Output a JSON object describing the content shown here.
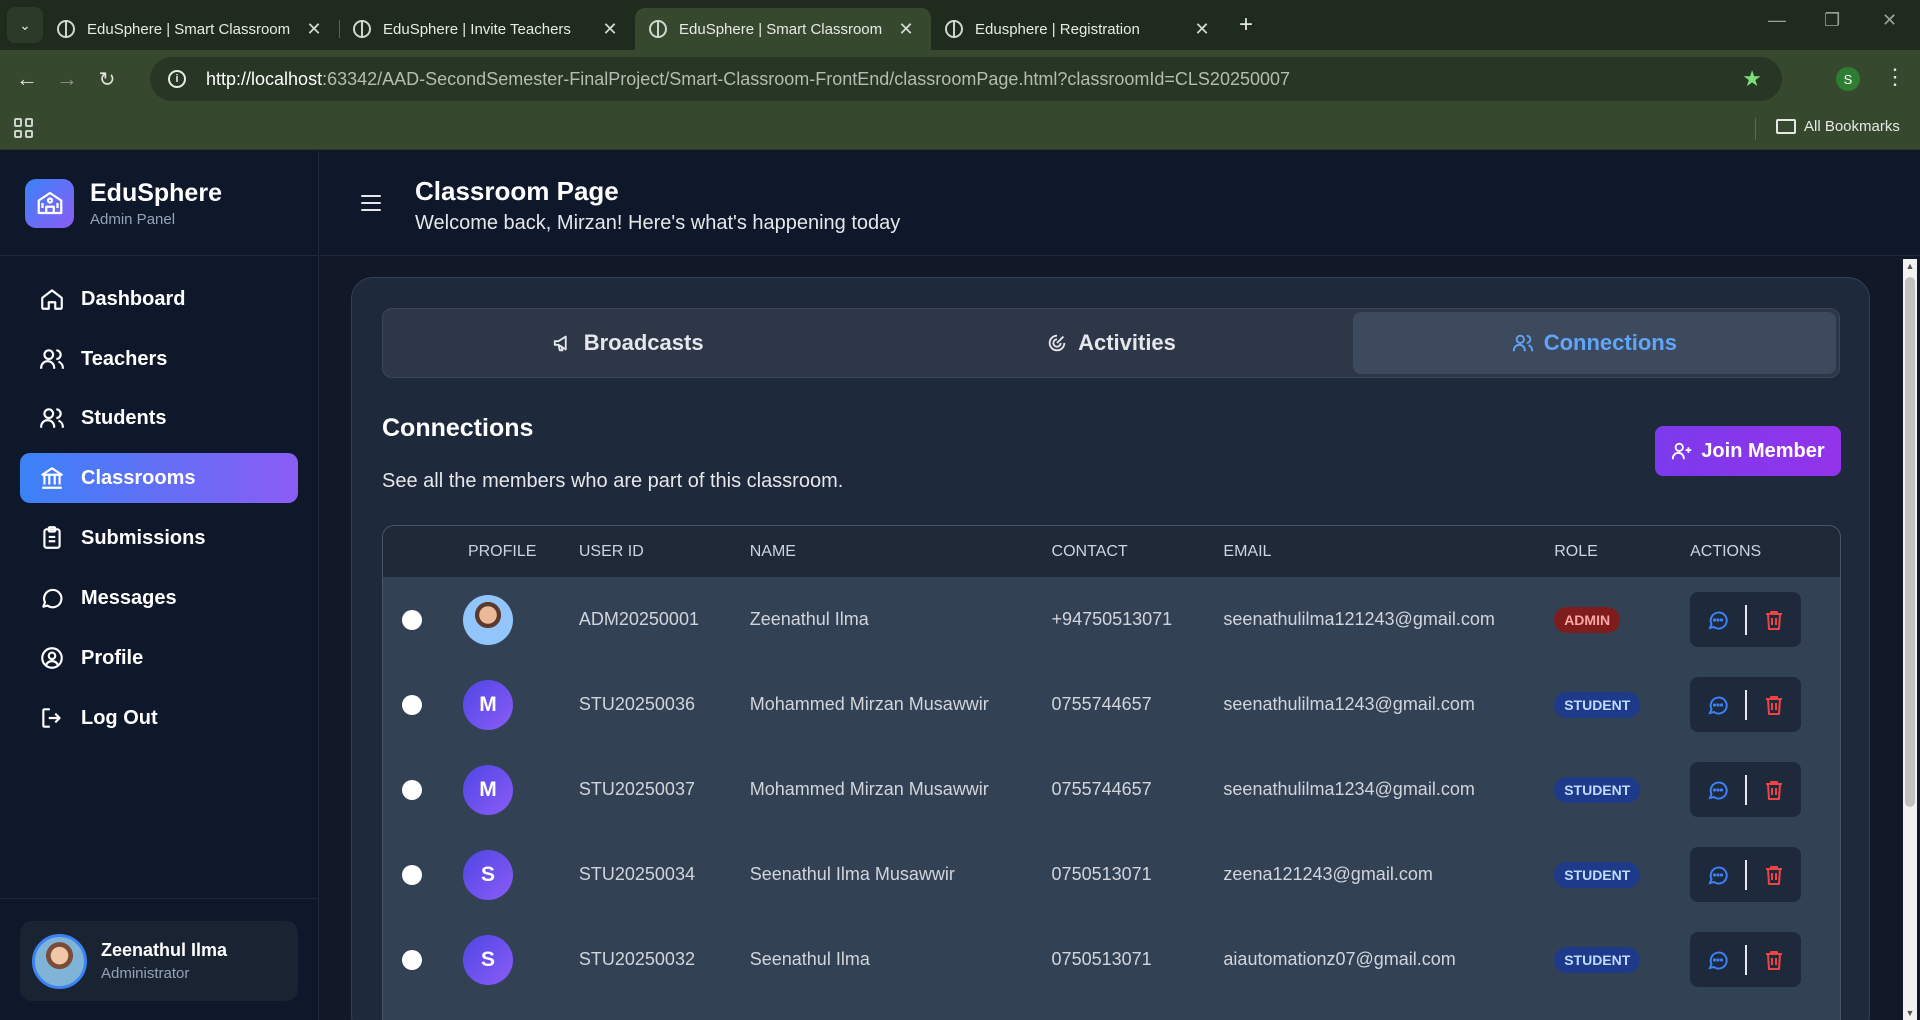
{
  "browser": {
    "tabs": [
      {
        "title": "EduSphere | Smart Classroom",
        "active": false
      },
      {
        "title": "EduSphere | Invite Teachers",
        "active": false
      },
      {
        "title": "EduSphere | Smart Classroom",
        "active": true
      },
      {
        "title": "Edusphere | Registration",
        "active": false
      }
    ],
    "url_host": "http://localhost",
    "url_rest": ":63342/AAD-SecondSemester-FinalProject/Smart-Classroom-FrontEnd/classroomPage.html?classroomId=CLS20250007",
    "profile_initial": "S",
    "all_bookmarks": "All Bookmarks"
  },
  "sidebar": {
    "brand_name": "EduSphere",
    "brand_sub": "Admin Panel",
    "items": [
      {
        "label": "Dashboard",
        "icon": "home-icon"
      },
      {
        "label": "Teachers",
        "icon": "users-icon"
      },
      {
        "label": "Students",
        "icon": "users-icon"
      },
      {
        "label": "Classrooms",
        "icon": "building-icon",
        "active": true
      },
      {
        "label": "Submissions",
        "icon": "clipboard-icon"
      },
      {
        "label": "Messages",
        "icon": "message-icon"
      },
      {
        "label": "Profile",
        "icon": "user-circle-icon"
      },
      {
        "label": "Log Out",
        "icon": "logout-icon"
      }
    ],
    "user": {
      "name": "Zeenathul Ilma",
      "role": "Administrator"
    }
  },
  "header": {
    "title": "Classroom Page",
    "subtitle": "Welcome back, Mirzan! Here's what's happening today"
  },
  "tabs": [
    {
      "label": "Broadcasts",
      "icon": "megaphone-icon"
    },
    {
      "label": "Activities",
      "icon": "activity-icon"
    },
    {
      "label": "Connections",
      "icon": "users-icon",
      "active": true
    }
  ],
  "connections": {
    "title": "Connections",
    "description": "See all the members who are part of this classroom.",
    "join_label": "Join Member",
    "columns": [
      "PROFILE",
      "USER ID",
      "NAME",
      "CONTACT",
      "EMAIL",
      "ROLE",
      "ACTIONS"
    ],
    "rows": [
      {
        "initial": "",
        "user_id": "ADM20250001",
        "name": "Zeenathul Ilma",
        "contact": "+94750513071",
        "email": "seenathulilma121243@gmail.com",
        "role": "ADMIN"
      },
      {
        "initial": "M",
        "user_id": "STU20250036",
        "name": "Mohammed Mirzan Musawwir",
        "contact": "0755744657",
        "email": "seenathulilma1243@gmail.com",
        "role": "STUDENT"
      },
      {
        "initial": "M",
        "user_id": "STU20250037",
        "name": "Mohammed Mirzan Musawwir",
        "contact": "0755744657",
        "email": "seenathulilma1234@gmail.com",
        "role": "STUDENT"
      },
      {
        "initial": "S",
        "user_id": "STU20250034",
        "name": "Seenathul Ilma Musawwir",
        "contact": "0750513071",
        "email": "zeena121243@gmail.com",
        "role": "STUDENT"
      },
      {
        "initial": "S",
        "user_id": "STU20250032",
        "name": "Seenathul Ilma",
        "contact": "0750513071",
        "email": "aiautomationz07@gmail.com",
        "role": "STUDENT"
      }
    ]
  },
  "colors": {
    "accent_blue": "#3b82f6",
    "accent_purple": "#8b5cf6",
    "delete_red": "#ef4444"
  }
}
